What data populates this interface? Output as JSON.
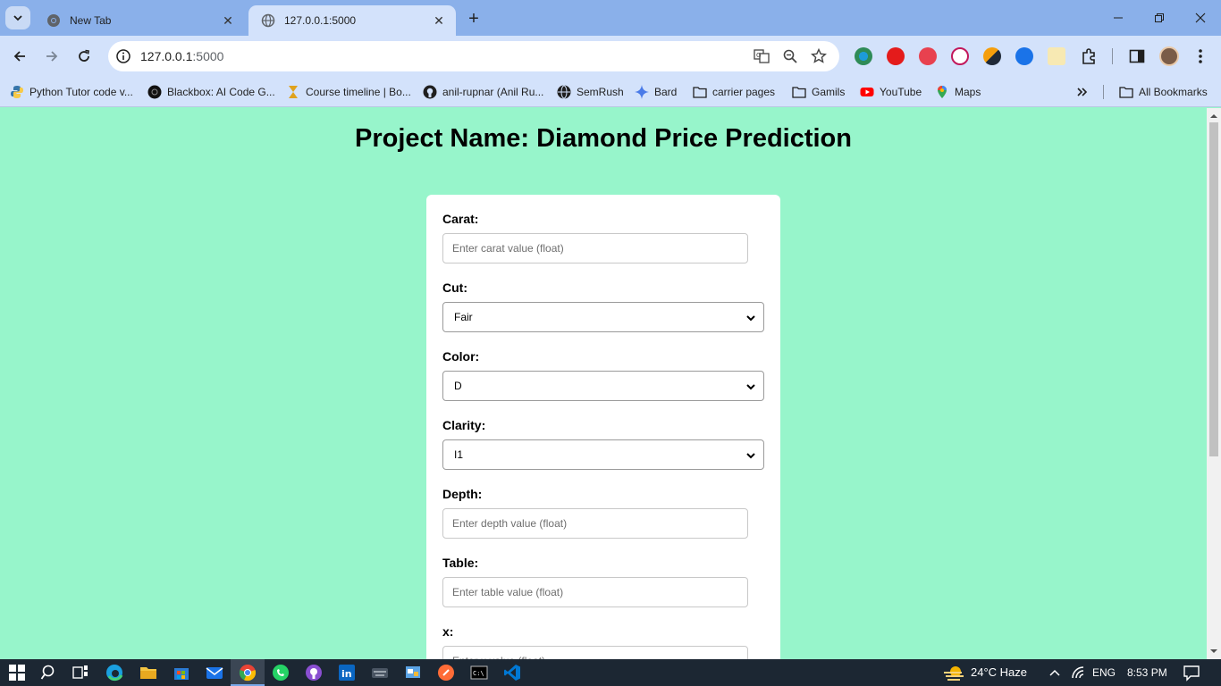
{
  "browser": {
    "tabs": [
      {
        "title": "New Tab",
        "active": false,
        "icon": "chrome-icon"
      },
      {
        "title": "127.0.0.1:5000",
        "active": true,
        "icon": "globe-icon"
      }
    ],
    "address": {
      "host": "127.0.0.1",
      "port": ":5000"
    },
    "bookmarks": [
      {
        "label": "Python Tutor code v...",
        "icon": "python-icon"
      },
      {
        "label": "Blackbox: AI Code G...",
        "icon": "blackbox-icon"
      },
      {
        "label": "Course timeline | Bo...",
        "icon": "hourglass-icon"
      },
      {
        "label": "anil-rupnar (Anil Ru...",
        "icon": "github-icon"
      },
      {
        "label": "SemRush",
        "icon": "globe-icon"
      },
      {
        "label": "Bard",
        "icon": "sparkle-icon"
      },
      {
        "label": "carrier pages",
        "icon": "folder-icon"
      },
      {
        "label": "Gamils",
        "icon": "folder-icon"
      },
      {
        "label": "YouTube",
        "icon": "youtube-icon"
      },
      {
        "label": "Maps",
        "icon": "maps-icon"
      }
    ],
    "all_bookmarks": "All Bookmarks"
  },
  "page": {
    "title": "Project Name: Diamond Price Prediction",
    "fields": {
      "carat": {
        "label": "Carat:",
        "placeholder": "Enter carat value (float)"
      },
      "cut": {
        "label": "Cut:",
        "value": "Fair"
      },
      "color": {
        "label": "Color:",
        "value": "D"
      },
      "clarity": {
        "label": "Clarity:",
        "value": "I1"
      },
      "depth": {
        "label": "Depth:",
        "placeholder": "Enter depth value (float)"
      },
      "table": {
        "label": "Table:",
        "placeholder": "Enter table value (float)"
      },
      "x": {
        "label": "x:",
        "placeholder": "Enter x value (float)"
      }
    },
    "background": "#97f5cb"
  },
  "taskbar": {
    "weather": "24°C  Haze",
    "language": "ENG",
    "time": "8:53 PM"
  }
}
